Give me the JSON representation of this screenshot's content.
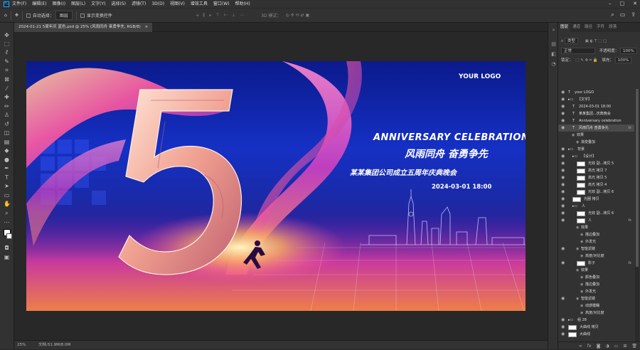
{
  "app": {
    "logo": "Ps"
  },
  "menu": [
    "文件(F)",
    "编辑(E)",
    "图像(I)",
    "图层(L)",
    "文字(Y)",
    "选择(S)",
    "滤镜(T)",
    "3D(D)",
    "视图(V)",
    "增效工具",
    "窗口(W)",
    "帮助(H)"
  ],
  "window_controls": {
    "minimize": "–",
    "maximize": "□",
    "close": "✕"
  },
  "options_bar": {
    "auto_select_label": "自动选择：",
    "auto_select_value": "图层",
    "transform_label": "显示变换控件",
    "mode3d_label": "3D 模式："
  },
  "document_tab": {
    "title": "2024-01-21 5周年庆 蓝色.psd @ 25% (风雨同舟 奋勇争先, RGB/8)",
    "close": "×"
  },
  "canvas": {
    "logo_text": "YOUR LOGO",
    "anniversary": "ANNIVERSARY  CELEBRATION",
    "slogan": "风雨同舟  奋勇争先",
    "event": "某某集团公司成立五周年庆典晚会",
    "datetime": "2024-03-01  18:00",
    "big_number": "5"
  },
  "status_bar": {
    "zoom": "25%",
    "doc": "文档:51.9M/8.0M"
  },
  "panel": {
    "tabs": [
      "图层",
      "通道",
      "路径",
      "字符",
      "段落"
    ],
    "filter_kind": "类型",
    "blend_mode": "正常",
    "opacity_label": "不透明度：",
    "opacity_value": "100%",
    "lock_label": "锁定：",
    "fill_label": "填充：",
    "fill_value": "100%"
  },
  "layers": [
    {
      "name": "your LOGO",
      "type": "text",
      "indent": 0
    },
    {
      "name": "【文字】",
      "type": "folder",
      "indent": 0
    },
    {
      "name": "2024-03-01 18:00",
      "type": "text",
      "indent": 1
    },
    {
      "name": "某某集团...庆典晚会",
      "type": "text",
      "indent": 1
    },
    {
      "name": "Anniversary celebration",
      "type": "text",
      "indent": 1
    },
    {
      "name": "风雨同舟 奋勇争先",
      "type": "text",
      "indent": 1,
      "fx": true,
      "selected": true
    },
    {
      "name": "效果",
      "type": "effect",
      "indent": 2
    },
    {
      "name": "渐变叠加",
      "type": "effect",
      "indent": 3
    },
    {
      "name": "背景",
      "type": "folder",
      "indent": 0
    },
    {
      "name": "【设计】",
      "type": "folder",
      "indent": 1
    },
    {
      "name": "光效 副...拷贝 5",
      "type": "pixel",
      "indent": 2
    },
    {
      "name": "高光 拷贝 7",
      "type": "pixel",
      "indent": 2
    },
    {
      "name": "高光 拷贝 5",
      "type": "pixel",
      "indent": 2
    },
    {
      "name": "高光 拷贝 4",
      "type": "pixel",
      "indent": 2
    },
    {
      "name": "光效 副...拷贝 6",
      "type": "pixel",
      "indent": 2
    },
    {
      "name": "光圈 拷贝",
      "type": "pixel",
      "indent": 1
    },
    {
      "name": "人",
      "type": "folder",
      "indent": 1
    },
    {
      "name": "光效 副...拷贝 6",
      "type": "pixel",
      "indent": 2
    },
    {
      "name": "人",
      "type": "pixel",
      "indent": 2,
      "fx": true
    },
    {
      "name": "效果",
      "type": "effect",
      "indent": 3
    },
    {
      "name": "描边叠加",
      "type": "effect",
      "indent": 4
    },
    {
      "name": "外发光",
      "type": "effect",
      "indent": 4
    },
    {
      "name": "智能滤镜",
      "type": "smart",
      "indent": 3
    },
    {
      "name": "高度/对比度",
      "type": "effect",
      "indent": 4
    },
    {
      "name": "影子",
      "type": "pixel",
      "indent": 2,
      "fx": true
    },
    {
      "name": "效果",
      "type": "effect",
      "indent": 3
    },
    {
      "name": "颜色叠加",
      "type": "effect",
      "indent": 4
    },
    {
      "name": "描边叠加",
      "type": "effect",
      "indent": 4
    },
    {
      "name": "外发光",
      "type": "effect",
      "indent": 4
    },
    {
      "name": "智能滤镜",
      "type": "smart",
      "indent": 3
    },
    {
      "name": "动感模糊",
      "type": "effect",
      "indent": 4
    },
    {
      "name": "高度/对比度",
      "type": "effect",
      "indent": 4
    },
    {
      "name": "组 28",
      "type": "folder",
      "indent": 0
    },
    {
      "name": "大曲线 拷贝",
      "type": "pixel",
      "indent": 0
    },
    {
      "name": "大曲线",
      "type": "pixel",
      "indent": 0
    }
  ],
  "colors": {
    "canvas_top": "#0b1a8c",
    "canvas_mid": "#1530c4",
    "canvas_bottom": "#8a1a7a",
    "ui_bg": "#323232",
    "ui_dark": "#282828",
    "accent": "#31a8ff"
  },
  "icons": {
    "tools": [
      "move-icon",
      "marquee-icon",
      "lasso-icon",
      "quick-select-icon",
      "crop-icon",
      "frame-icon",
      "eyedropper-icon",
      "heal-icon",
      "brush-icon",
      "stamp-icon",
      "history-brush-icon",
      "eraser-icon",
      "gradient-icon",
      "blur-icon",
      "dodge-icon",
      "pen-icon",
      "type-icon",
      "path-select-icon",
      "shape-icon",
      "hand-icon",
      "zoom-icon"
    ]
  }
}
